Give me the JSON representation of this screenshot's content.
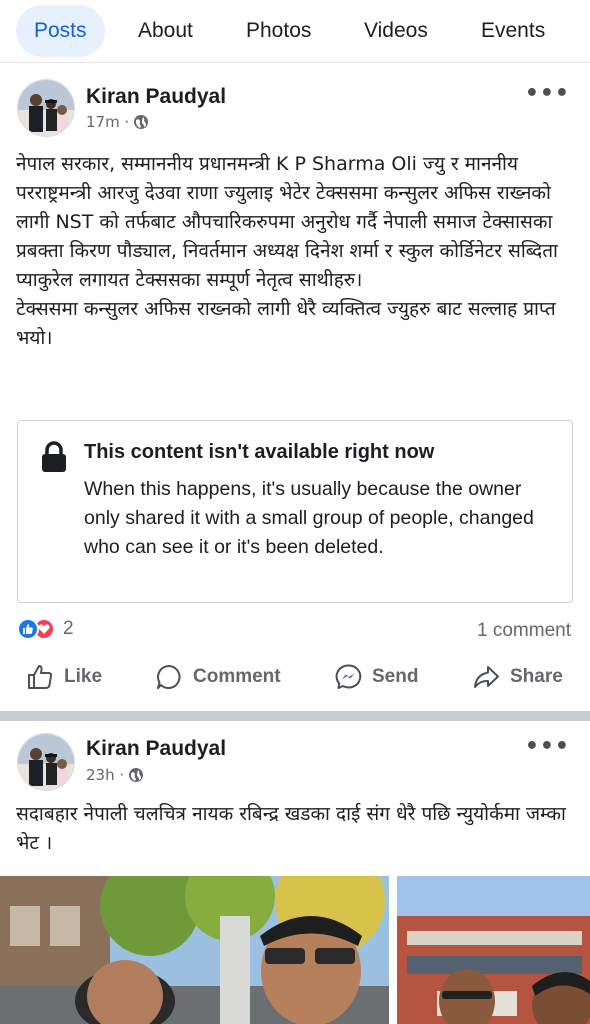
{
  "tabs": [
    {
      "label": "Posts",
      "active": true
    },
    {
      "label": "About",
      "active": false
    },
    {
      "label": "Photos",
      "active": false
    },
    {
      "label": "Videos",
      "active": false
    },
    {
      "label": "Events",
      "active": false
    }
  ],
  "post1": {
    "author": "Kiran Paudyal",
    "time": "17m ·",
    "text": "नेपाल सरकार, सम्माननीय प्रधानमन्त्री K P Sharma Oli ज्यु र माननीय परराष्ट्रमन्त्री आरजु देउवा राणा ज्युलाइ भेटेर टेक्ससमा कन्सुलर अफिस राख्नको लागी NST को तर्फबाट औपचारिकरुपमा अनुरोध गर्दै नेपाली समाज टेक्सासका प्रबक्ता किरण पौड्याल, निवर्तमान अध्यक्ष दिनेश शर्मा र स्कुल कोर्डिनेटर सब्दिता प्याकुरेल लगायत टेक्ससका सम्पूर्ण नेतृत्व साथीहरु।\nटेक्ससमा कन्सुलर अफिस राख्नको लागी धेरै व्यक्तित्व ज्युहरु बाट सल्लाह प्राप्त भयो।",
    "unavailable_title": "This content isn't available right now",
    "unavailable_body": "When this happens, it's usually because the owner only shared it with a small group of people, changed who can see it or it's been deleted.",
    "reaction_count": "2",
    "comment_count": "1 comment"
  },
  "actions": {
    "like": "Like",
    "comment": "Comment",
    "send": "Send",
    "share": "Share"
  },
  "post2": {
    "author": "Kiran Paudyal",
    "time": "23h ·",
    "text": "सदाबहार नेपाली चलचित्र नायक रबिन्द्र खडका दाई संग धेरै पछि न्युयोर्कमा जम्का भेट ।"
  },
  "colors": {
    "accent": "#1461d1",
    "like": "#1877f2",
    "love": "#f33e58"
  }
}
